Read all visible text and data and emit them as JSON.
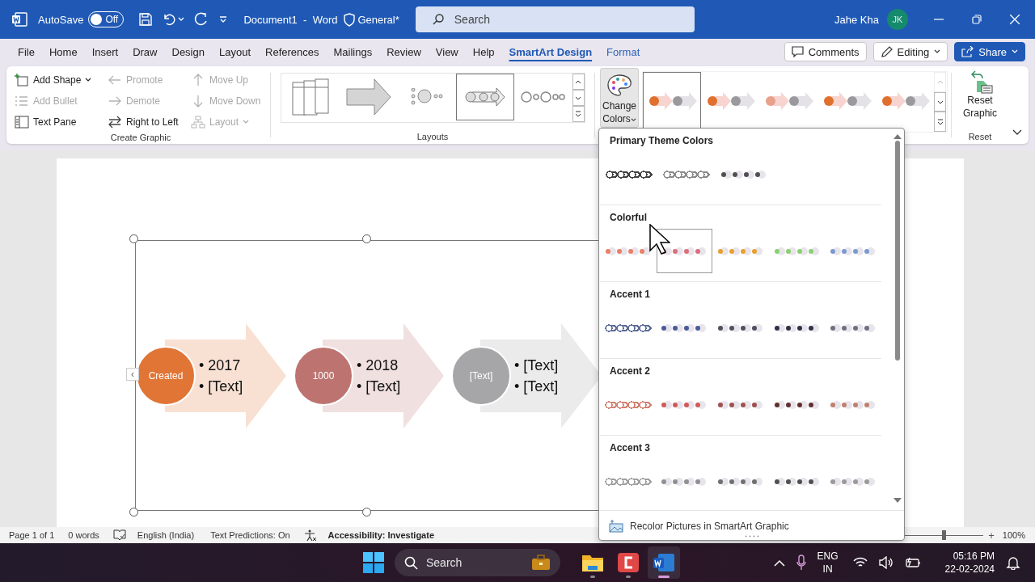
{
  "title_bar": {
    "autosave_label": "AutoSave",
    "autosave": {
      "on": false,
      "label": "Off"
    },
    "document_title": "Document1  -  Word",
    "sensitivity": "General*",
    "search": {
      "placeholder": "Search"
    },
    "user_name": "Jahe Kha",
    "avatar_initials": "JK"
  },
  "tabs": [
    {
      "label": "File",
      "selected": false,
      "contextual": false
    },
    {
      "label": "Home",
      "selected": false,
      "contextual": false
    },
    {
      "label": "Insert",
      "selected": false,
      "contextual": false
    },
    {
      "label": "Draw",
      "selected": false,
      "contextual": false
    },
    {
      "label": "Design",
      "selected": false,
      "contextual": false
    },
    {
      "label": "Layout",
      "selected": false,
      "contextual": false
    },
    {
      "label": "References",
      "selected": false,
      "contextual": false
    },
    {
      "label": "Mailings",
      "selected": false,
      "contextual": false
    },
    {
      "label": "Review",
      "selected": false,
      "contextual": false
    },
    {
      "label": "View",
      "selected": false,
      "contextual": false
    },
    {
      "label": "Help",
      "selected": false,
      "contextual": false
    },
    {
      "label": "SmartArt Design",
      "selected": true,
      "contextual": true
    },
    {
      "label": "Format",
      "selected": false,
      "contextual": true
    }
  ],
  "tab_actions": {
    "comments": "Comments",
    "editing": "Editing",
    "share": "Share"
  },
  "ribbon": {
    "create_graphic": {
      "label": "Create Graphic",
      "commands": [
        {
          "label": "Add Shape",
          "disabled": false,
          "dropdown": true
        },
        {
          "label": "Add Bullet",
          "disabled": true,
          "dropdown": false
        },
        {
          "label": "Text Pane",
          "disabled": false,
          "dropdown": false
        },
        {
          "label": "Promote",
          "disabled": true,
          "dropdown": false
        },
        {
          "label": "Demote",
          "disabled": true,
          "dropdown": false
        },
        {
          "label": "Right to Left",
          "disabled": false,
          "dropdown": false
        },
        {
          "label": "Move Up",
          "disabled": true,
          "dropdown": false
        },
        {
          "label": "Move Down",
          "disabled": true,
          "dropdown": false
        },
        {
          "label": "Layout",
          "disabled": true,
          "dropdown": true
        }
      ]
    },
    "layouts": {
      "label": "Layouts",
      "items": [
        {
          "kind": "stacked-list",
          "selected": false
        },
        {
          "kind": "block-arrow",
          "selected": false
        },
        {
          "kind": "dotted-process",
          "selected": false
        },
        {
          "kind": "circle-arrow-process",
          "selected": true
        },
        {
          "kind": "ring-process",
          "selected": false
        }
      ]
    },
    "change_colors": {
      "label": "Change Colors",
      "expanded": true
    },
    "styles": {
      "items": [
        {
          "color": "#e0702e",
          "selected": true
        },
        {
          "color": "#e0702e",
          "selected": false
        },
        {
          "color": "#e8a08a",
          "selected": false
        },
        {
          "color": "#e0702e",
          "selected": false
        },
        {
          "color": "#e0702e",
          "selected": false
        }
      ]
    },
    "reset": {
      "button": "Reset Graphic",
      "label": "Reset"
    }
  },
  "document": {
    "text_pane_toggle": "‹",
    "diagram": [
      {
        "text": "Created",
        "color": "#e07535",
        "bullets": [
          "• 2017",
          "• [Text]"
        ]
      },
      {
        "text": "1000",
        "color": "#bd7470",
        "bullets": [
          "• 2018",
          "• [Text]"
        ]
      },
      {
        "text": "[Text]",
        "color": "#a6a6a8",
        "bullets": [
          "• [Text]",
          "• [Text]"
        ]
      }
    ]
  },
  "colors_menu": {
    "sections": [
      {
        "title": "Primary Theme Colors",
        "variants": [
          {
            "kind": "outline",
            "color": "#404040",
            "selected": false
          },
          {
            "kind": "outline",
            "color": "#8a8a8a",
            "selected": false
          },
          {
            "kind": "dots",
            "color": "#505050",
            "selected": false
          }
        ]
      },
      {
        "title": "Colorful",
        "variants": [
          {
            "kind": "dots",
            "color": "#e8806a",
            "selected": false
          },
          {
            "kind": "dots",
            "color": "#d9707a",
            "selected": true
          },
          {
            "kind": "dots",
            "color": "#e8a030",
            "selected": false
          },
          {
            "kind": "dots",
            "color": "#8cd070",
            "selected": false
          },
          {
            "kind": "dots",
            "color": "#7a9ad0",
            "selected": false
          }
        ]
      },
      {
        "title": "Accent 1",
        "variants": [
          {
            "kind": "outline",
            "color": "#5a6a9a",
            "selected": false
          },
          {
            "kind": "dots",
            "color": "#4a5a9a",
            "selected": false
          },
          {
            "kind": "dots",
            "color": "#505060",
            "selected": false
          },
          {
            "kind": "dots",
            "color": "#303048",
            "selected": false
          },
          {
            "kind": "dots",
            "color": "#707080",
            "selected": false
          }
        ]
      },
      {
        "title": "Accent 2",
        "variants": [
          {
            "kind": "outline",
            "color": "#d08070",
            "selected": false
          },
          {
            "kind": "dots",
            "color": "#d05a5a",
            "selected": false
          },
          {
            "kind": "dots",
            "color": "#a05050",
            "selected": false
          },
          {
            "kind": "dots",
            "color": "#603030",
            "selected": false
          },
          {
            "kind": "dots",
            "color": "#c08070",
            "selected": false
          }
        ]
      },
      {
        "title": "Accent 3",
        "variants": [
          {
            "kind": "outline",
            "color": "#a0a0a0",
            "selected": false
          },
          {
            "kind": "dots",
            "color": "#909090",
            "selected": false
          },
          {
            "kind": "dots",
            "color": "#707070",
            "selected": false
          },
          {
            "kind": "dots",
            "color": "#505050",
            "selected": false
          },
          {
            "kind": "dots",
            "color": "#9a9a9a",
            "selected": false
          }
        ]
      }
    ],
    "footer": "Recolor Pictures in SmartArt Graphic"
  },
  "status_bar": {
    "page": "Page 1 of 1",
    "words": "0 words",
    "language": "English (India)",
    "text_predictions": "Text Predictions: On",
    "accessibility": "Accessibility: Investigate",
    "zoom": {
      "level": 0.5,
      "plus": "+",
      "percent": "100%"
    }
  },
  "taskbar": {
    "search": {
      "placeholder": "Search"
    },
    "apps": [
      {
        "kind": "explorer",
        "active": false
      },
      {
        "kind": "red-app",
        "active": false
      },
      {
        "kind": "word",
        "active": true
      }
    ],
    "language": [
      "ENG",
      "IN"
    ],
    "time": "05:16 PM",
    "date": "22-02-2024"
  }
}
